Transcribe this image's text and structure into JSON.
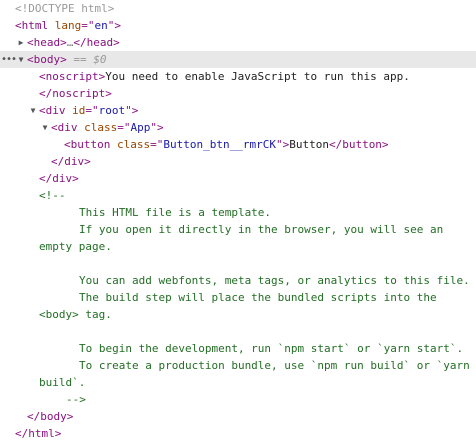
{
  "doctype": "<!DOCTYPE html>",
  "html_open": {
    "tag": "<html",
    "attr": "lang",
    "eq": "=\"",
    "val": "en",
    "close": "\">"
  },
  "head_collapsed": {
    "open": "<head>",
    "ellipsis": "…",
    "close": "</head>"
  },
  "body_open": {
    "tag": "<body>",
    "marker": "== $0"
  },
  "noscript": {
    "open": "<noscript>",
    "text": "You need to enable JavaScript to run this app.",
    "close": "</noscript>"
  },
  "div_root": {
    "tag": "<div",
    "attr": "id",
    "val": "root",
    "close": ">"
  },
  "div_app": {
    "tag": "<div",
    "attr": "class",
    "val": "App",
    "close": ">"
  },
  "button_el": {
    "tag": "<button",
    "attr": "class",
    "val": "Button_btn__rmrCK",
    "text": "Button",
    "close": "</button>"
  },
  "div_close_1": "</div>",
  "div_close_2": "</div>",
  "comment_open": "<!--",
  "comment_lines": [
    "This HTML file is a template.",
    "If you open it directly in the browser, you will see an",
    "empty page.",
    "You can add webfonts, meta tags, or analytics to this file.",
    "The build step will place the bundled scripts into the",
    "<body> tag.",
    "To begin the development, run `npm start` or `yarn start`.",
    "To create a production bundle, use `npm run build` or `yarn",
    "build`."
  ],
  "comment_close": "-->",
  "body_close": "</body>",
  "html_close": "</html>",
  "icons": {
    "expanded": "expanded-triangle-icon",
    "collapsed": "collapsed-triangle-icon",
    "more": "ellipsis-icon"
  }
}
